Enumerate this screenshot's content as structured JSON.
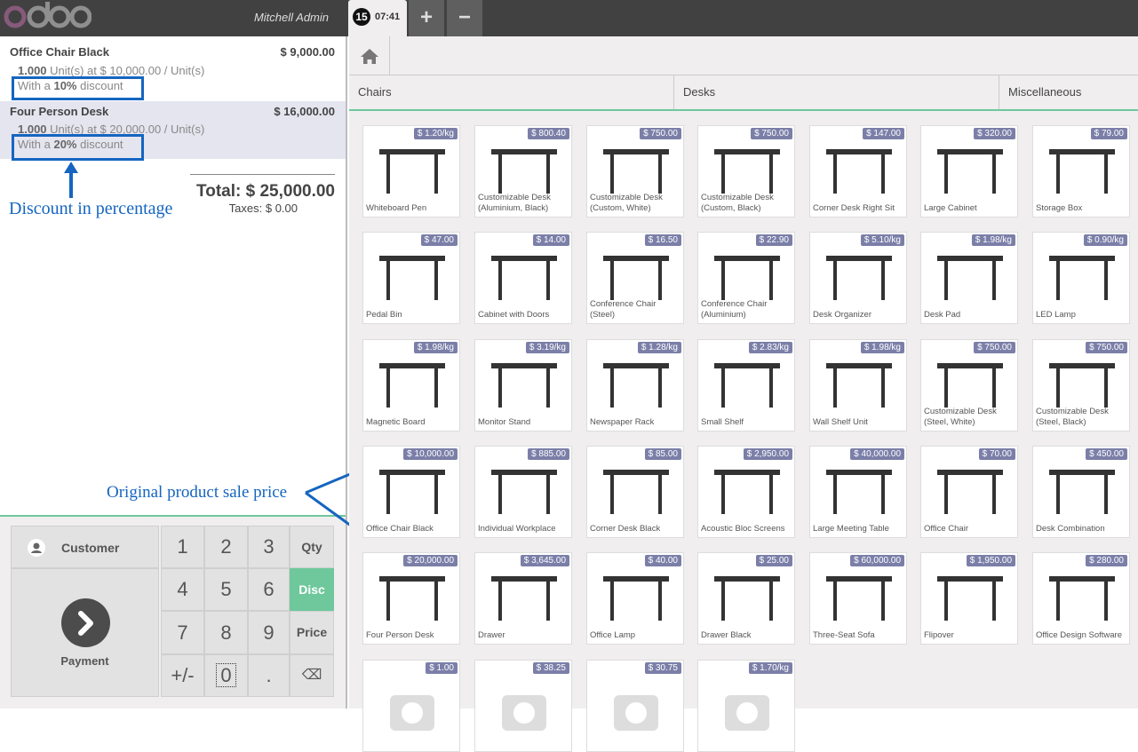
{
  "header": {
    "cashier": "Mitchell Admin",
    "order_number": "15",
    "order_time": "07:41",
    "add_label": "+",
    "remove_label": "−"
  },
  "orderlines": [
    {
      "name": "Office Chair Black",
      "price": "$ 9,000.00",
      "qty": "1.000",
      "unit_info": "Unit(s) at $ 10,000.00 / Unit(s)",
      "disc_prefix": "With a",
      "disc_value": "10%",
      "disc_suffix": "discount"
    },
    {
      "name": "Four Person Desk",
      "price": "$ 16,000.00",
      "qty": "1.000",
      "unit_info": "Unit(s) at $ 20,000.00 / Unit(s)",
      "disc_prefix": "With a",
      "disc_value": "20%",
      "disc_suffix": "discount"
    }
  ],
  "summary": {
    "total": "Total: $ 25,000.00",
    "taxes": "Taxes: $ 0.00"
  },
  "annotations": {
    "discount": "Discount in percentage",
    "sale_price": "Original product sale price"
  },
  "numpad": {
    "customer": "Customer",
    "payment": "Payment",
    "keys": [
      "1",
      "2",
      "3",
      "4",
      "5",
      "6",
      "7",
      "8",
      "9",
      "+/-",
      "0",
      "."
    ],
    "modes": [
      "Qty",
      "Disc",
      "Price"
    ],
    "backspace": "⌫"
  },
  "categories": [
    "Chairs",
    "Desks",
    "Miscellaneous"
  ],
  "products": [
    {
      "name": "Whiteboard Pen",
      "price": "$ 1.20/kg"
    },
    {
      "name": "Customizable Desk (Aluminium, Black)",
      "price": "$ 800.40"
    },
    {
      "name": "Customizable Desk (Custom, White)",
      "price": "$ 750.00"
    },
    {
      "name": "Customizable Desk (Custom, Black)",
      "price": "$ 750.00"
    },
    {
      "name": "Corner Desk Right Sit",
      "price": "$ 147.00"
    },
    {
      "name": "Large Cabinet",
      "price": "$ 320.00"
    },
    {
      "name": "Storage Box",
      "price": "$ 79.00"
    },
    {
      "name": "Pedal Bin",
      "price": "$ 47.00"
    },
    {
      "name": "Cabinet with Doors",
      "price": "$ 14.00"
    },
    {
      "name": "Conference Chair (Steel)",
      "price": "$ 16.50"
    },
    {
      "name": "Conference Chair (Aluminium)",
      "price": "$ 22.90"
    },
    {
      "name": "Desk Organizer",
      "price": "$ 5.10/kg"
    },
    {
      "name": "Desk Pad",
      "price": "$ 1.98/kg"
    },
    {
      "name": "LED Lamp",
      "price": "$ 0.90/kg"
    },
    {
      "name": "Magnetic Board",
      "price": "$ 1.98/kg"
    },
    {
      "name": "Monitor Stand",
      "price": "$ 3.19/kg"
    },
    {
      "name": "Newspaper Rack",
      "price": "$ 1.28/kg"
    },
    {
      "name": "Small Shelf",
      "price": "$ 2.83/kg"
    },
    {
      "name": "Wall Shelf Unit",
      "price": "$ 1.98/kg"
    },
    {
      "name": "Customizable Desk (Steel, White)",
      "price": "$ 750.00"
    },
    {
      "name": "Customizable Desk (Steel, Black)",
      "price": "$ 750.00"
    },
    {
      "name": "Office Chair Black",
      "price": "$ 10,000.00"
    },
    {
      "name": "Individual Workplace",
      "price": "$ 885.00"
    },
    {
      "name": "Corner Desk Black",
      "price": "$ 85.00"
    },
    {
      "name": "Acoustic Bloc Screens",
      "price": "$ 2,950.00"
    },
    {
      "name": "Large Meeting Table",
      "price": "$ 40,000.00"
    },
    {
      "name": "Office Chair",
      "price": "$ 70.00"
    },
    {
      "name": "Desk Combination",
      "price": "$ 450.00"
    },
    {
      "name": "Four Person Desk",
      "price": "$ 20,000.00"
    },
    {
      "name": "Drawer",
      "price": "$ 3,645.00"
    },
    {
      "name": "Office Lamp",
      "price": "$ 40.00"
    },
    {
      "name": "Drawer Black",
      "price": "$ 25.00"
    },
    {
      "name": "Three-Seat Sofa",
      "price": "$ 60,000.00"
    },
    {
      "name": "Flipover",
      "price": "$ 1,950.00"
    },
    {
      "name": "Office Design Software",
      "price": "$ 280.00"
    },
    {
      "name": "",
      "price": "$ 1.00"
    },
    {
      "name": "",
      "price": "$ 38.25"
    },
    {
      "name": "",
      "price": "$ 30.75"
    },
    {
      "name": "",
      "price": "$ 1.70/kg"
    }
  ],
  "colors": {
    "accent": "#6ec89b",
    "badge": "#7b7fa8",
    "annotation": "#1565c0",
    "logo": "#875a7b"
  },
  "icons": {
    "home": "home-icon",
    "customer": "user-icon",
    "payment": "chevron-right-icon",
    "backspace": "backspace-icon"
  }
}
